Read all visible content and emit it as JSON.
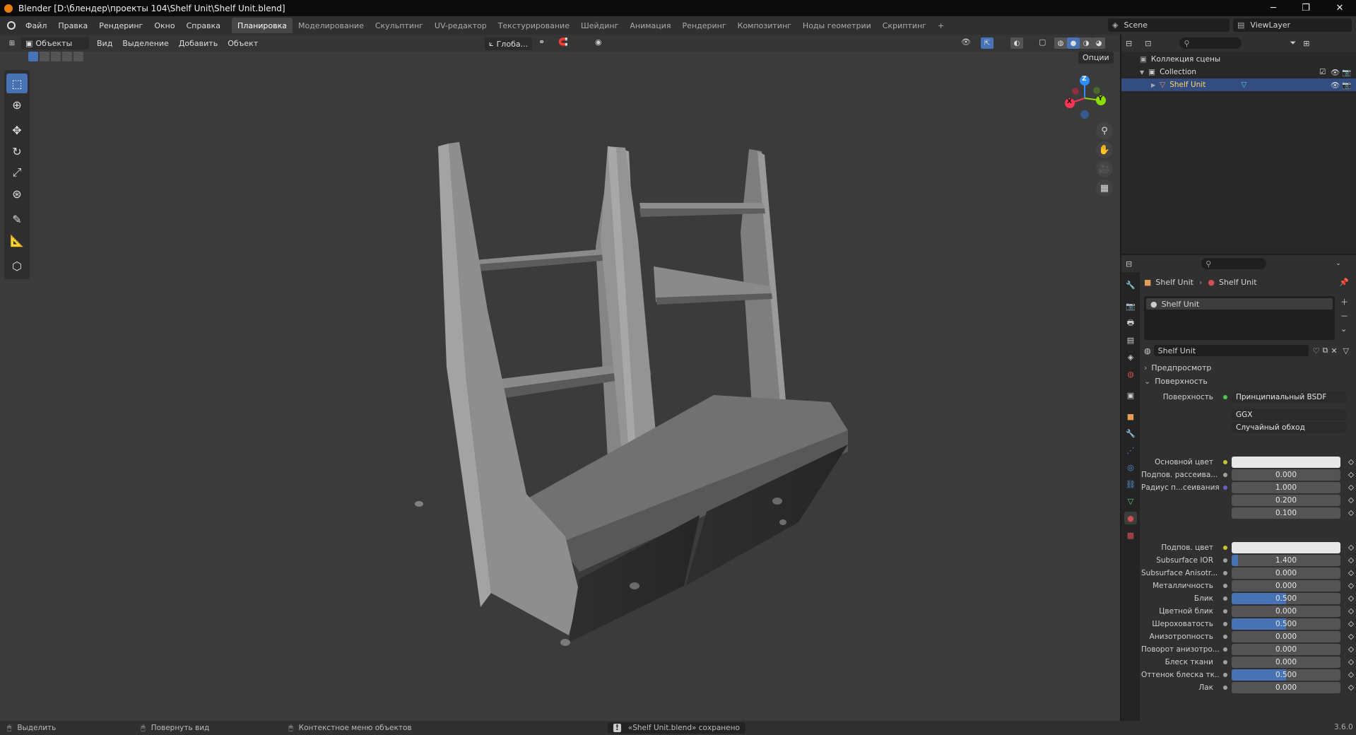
{
  "window": {
    "title": "Blender [D:\\блендер\\проекты 104\\Shelf Unit\\Shelf Unit.blend]",
    "min": "─",
    "max": "❐",
    "close": "✕"
  },
  "menu": [
    "Файл",
    "Правка",
    "Рендеринг",
    "Окно",
    "Справка"
  ],
  "workspaces": [
    "Планировка",
    "Моделирование",
    "Скульптинг",
    "UV-редактор",
    "Текстурирование",
    "Шейдинг",
    "Анимация",
    "Рендеринг",
    "Композитинг",
    "Ноды геометрии",
    "Скриптинг"
  ],
  "workspace_add": "+",
  "scene": {
    "name": "Scene",
    "view_layer": "ViewLayer"
  },
  "viewport": {
    "mode": "Объекты",
    "menus": [
      "Вид",
      "Выделение",
      "Добавить",
      "Объект"
    ],
    "orientation": "Глоба...",
    "options_label": "Опции",
    "gizmo": {
      "x": "X",
      "y": "Y",
      "z": "Z"
    }
  },
  "tools": [
    "select-box",
    "cursor",
    "move",
    "rotate",
    "scale",
    "transform",
    "annotate",
    "measure",
    "add-cube"
  ],
  "outliner": {
    "scene_collection": "Коллекция сцены",
    "collection": "Collection",
    "object": "Shelf Unit"
  },
  "properties": {
    "breadcrumb_object": "Shelf Unit",
    "breadcrumb_material": "Shelf Unit",
    "slot": "Shelf Unit",
    "material_name": "Shelf Unit",
    "preview_label": "Предпросмотр",
    "surface_label": "Поверхность",
    "surface_row_label": "Поверхность",
    "surface_value": "Принципиальный BSDF",
    "distribution": "GGX",
    "subsurface_method": "Случайный обход",
    "rows": [
      {
        "label": "Основной цвет",
        "type": "color",
        "color": "#e8e8e8"
      },
      {
        "label": "Подпов. рассеива...",
        "value": "0.000",
        "fill": 0
      },
      {
        "label": "Радиус п...сеивания",
        "value": "1.000",
        "fill": 0
      },
      {
        "label": "",
        "value": "0.200",
        "fill": 0
      },
      {
        "label": "",
        "value": "0.100",
        "fill": 0
      },
      {
        "label": "Подпов. цвет",
        "type": "color",
        "color": "#e8e8e8"
      },
      {
        "label": "Subsurface IOR",
        "value": "1.400",
        "fill": 0.12
      },
      {
        "label": "Subsurface Anisotr...",
        "value": "0.000",
        "fill": 0
      },
      {
        "label": "Металличность",
        "value": "0.000",
        "fill": 0
      },
      {
        "label": "Блик",
        "value": "0.500",
        "fill": 1
      },
      {
        "label": "Цветной блик",
        "value": "0.000",
        "fill": 0
      },
      {
        "label": "Шероховатость",
        "value": "0.500",
        "fill": 1
      },
      {
        "label": "Анизотропность",
        "value": "0.000",
        "fill": 0
      },
      {
        "label": "Поворот анизотро...",
        "value": "0.000",
        "fill": 0
      },
      {
        "label": "Блеск ткани",
        "value": "0.000",
        "fill": 0
      },
      {
        "label": "Оттенок блеска тк...",
        "value": "0.500",
        "fill": 1
      },
      {
        "label": "Лак",
        "value": "0.000",
        "fill": 0
      }
    ]
  },
  "status": {
    "select": "Выделить",
    "rotate": "Повернуть вид",
    "context": "Контекстное меню объектов",
    "message": "«Shelf Unit.blend» сохранено",
    "version": "3.6.0"
  },
  "colors": {
    "accent": "#4772b3",
    "selected_row": "#334d80",
    "logo": "#e87d0d"
  }
}
